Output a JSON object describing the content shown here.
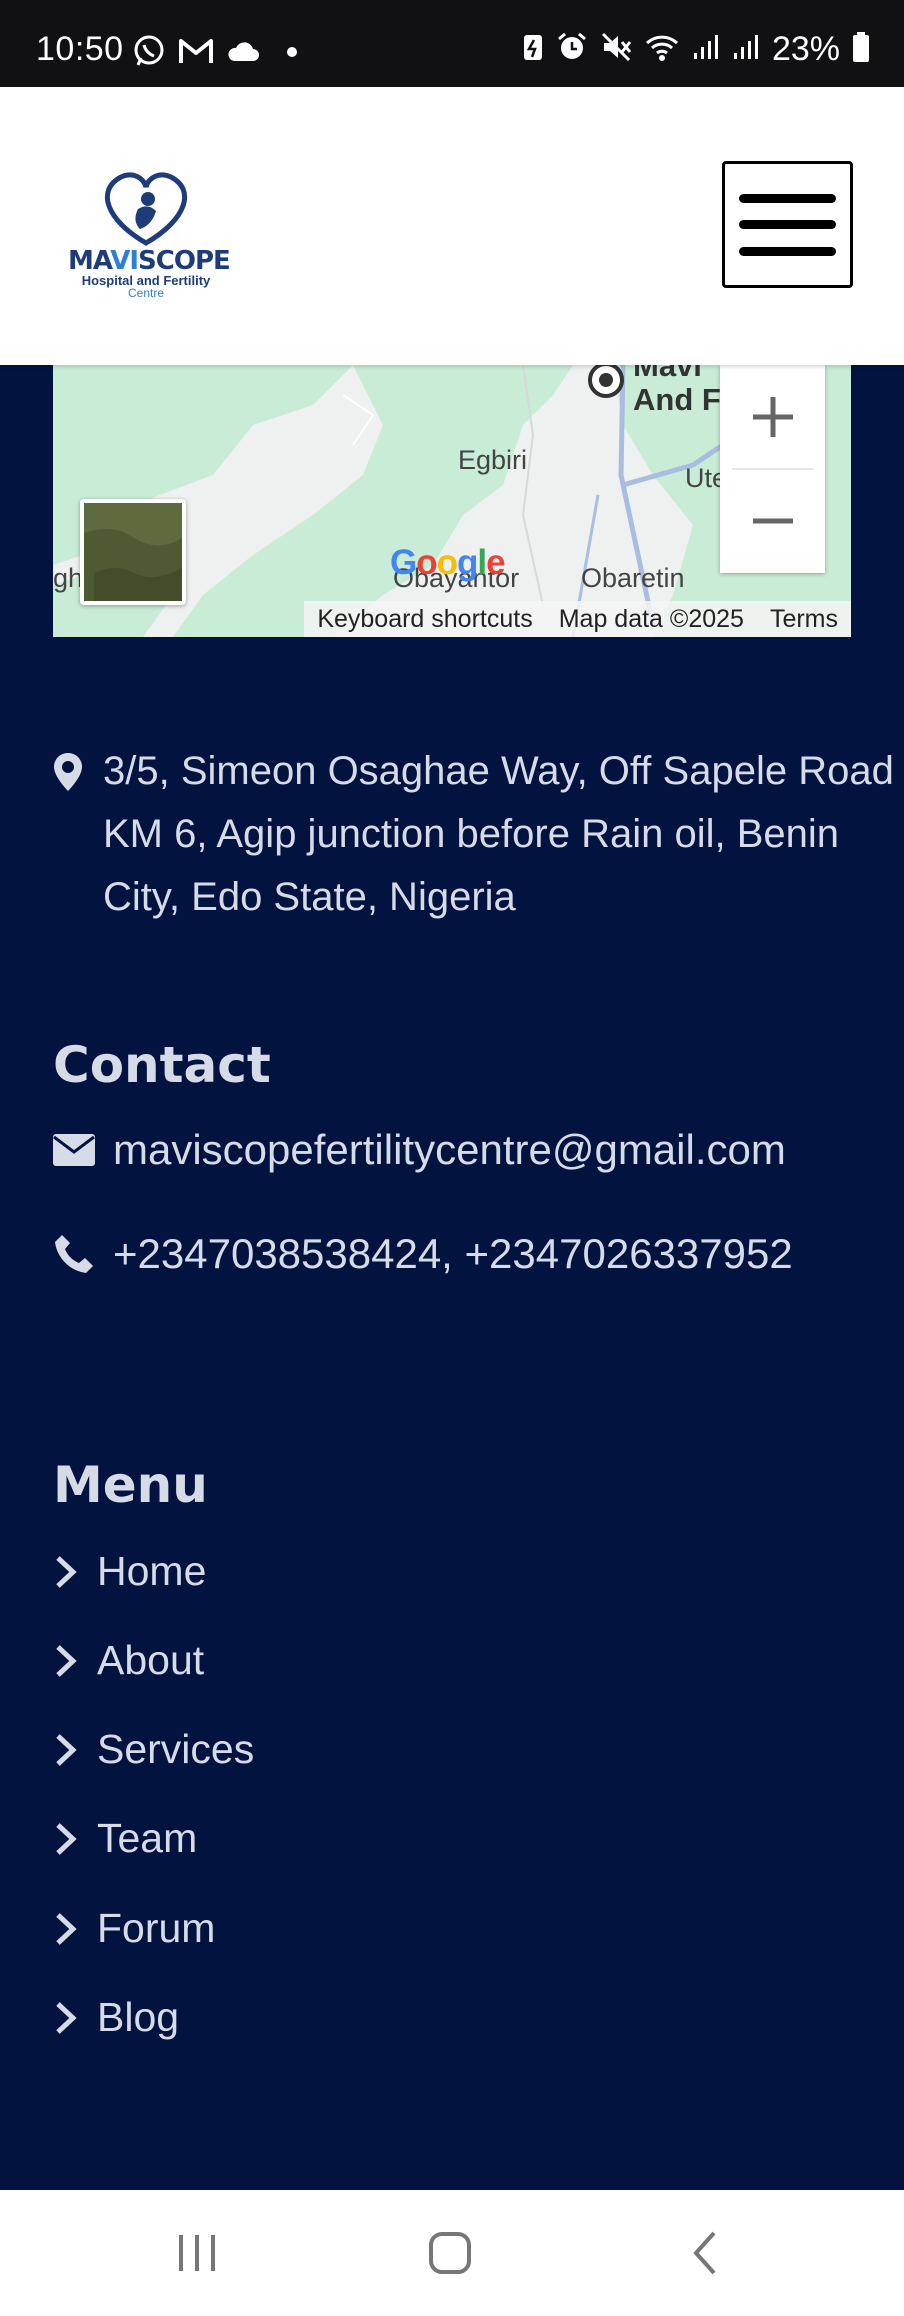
{
  "status_bar": {
    "time": "10:50",
    "battery": "23%",
    "left_icons": [
      "whatsapp-icon",
      "gmail-icon",
      "cloud-icon",
      "dot-icon"
    ],
    "right_icons": [
      "battery-saver-icon",
      "alarm-icon",
      "mute-icon",
      "wifi-icon",
      "signal-icon",
      "signal-icon-2",
      "battery-icon"
    ]
  },
  "header": {
    "logo_text_main_1": "MA",
    "logo_text_main_2": "VI",
    "logo_text_main_3": "SCOPE",
    "logo_text_sub": "Hospital and Fertility",
    "logo_text_sub2": "Centre"
  },
  "map": {
    "pin_label_1": "Mavi",
    "pin_label_2": "And F",
    "labels": [
      "Egbiri",
      "Ute",
      "Obayantor",
      "Obaretin",
      "gh"
    ],
    "keyboard_shortcuts": "Keyboard shortcuts",
    "map_data": "Map data ©2025",
    "terms": "Terms",
    "google": "Google"
  },
  "address": {
    "text": "3/5, Simeon Osaghae Way, Off Sapele Road KM 6, Agip junction before Rain oil, Benin City, Edo State, Nigeria"
  },
  "contact": {
    "title": "Contact",
    "email": "maviscopefertilitycentre@gmail.com",
    "phone": "+2347038538424, +2347026337952"
  },
  "menu": {
    "title": "Menu",
    "items": [
      "Home",
      "About",
      "Services",
      "Team",
      "Forum",
      "Blog"
    ]
  },
  "colors": {
    "background": "#03133f",
    "text": "#d6dbe8",
    "map_green": "#c8ecd6"
  }
}
